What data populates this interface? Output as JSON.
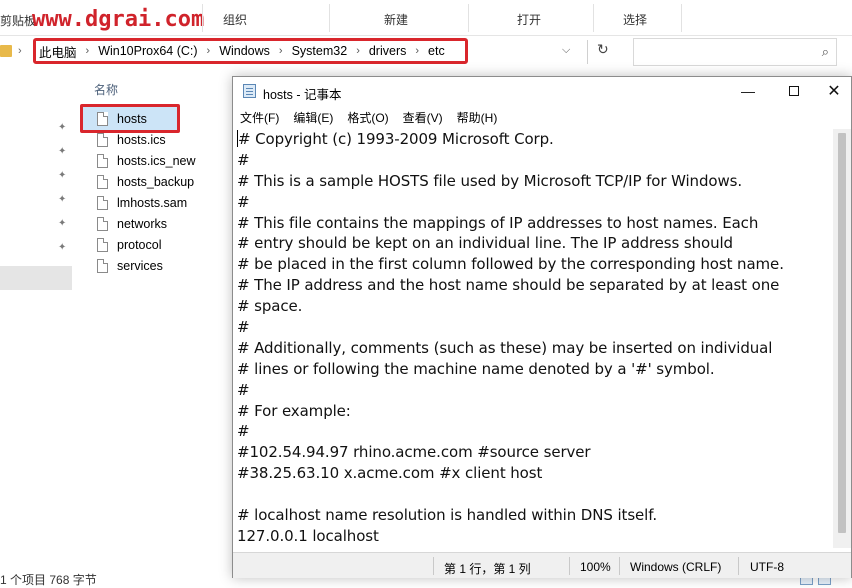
{
  "watermark": "www.dgrai.com",
  "ribbon": {
    "clipboard": "剪贴板",
    "organize": "组织",
    "new": "新建",
    "open": "打开",
    "select": "选择"
  },
  "address": {
    "crumbs": [
      "此电脑",
      "Win10Prox64 (C:)",
      "Windows",
      "System32",
      "drivers",
      "etc"
    ],
    "separator": "›"
  },
  "file_list": {
    "column_header": "名称",
    "files": [
      "hosts",
      "hosts.ics",
      "hosts.ics_new",
      "hosts_backup",
      "lmhosts.sam",
      "networks",
      "protocol",
      "services"
    ]
  },
  "explorer_status": "1 个项目   768 字节",
  "notepad": {
    "title": "hosts - 记事本",
    "menu": [
      "文件(F)",
      "编辑(E)",
      "格式(O)",
      "查看(V)",
      "帮助(H)"
    ],
    "lines": [
      "# Copyright (c) 1993-2009 Microsoft Corp.",
      "#",
      "# This is a sample HOSTS file used by Microsoft TCP/IP for Windows.",
      "#",
      "# This file contains the mappings of IP addresses to host names. Each",
      "# entry should be kept on an individual line. The IP address should",
      "# be placed in the first column followed by the corresponding host name.",
      "# The IP address and the host name should be separated by at least one",
      "# space.",
      "#",
      "# Additionally, comments (such as these) may be inserted on individual",
      "# lines or following the machine name denoted by a '#' symbol.",
      "#",
      "# For example:",
      "#",
      "#102.54.94.97 rhino.acme.com #source server",
      "#38.25.63.10 x.acme.com #x client host",
      "",
      "# localhost name resolution is handled within DNS itself.",
      "127.0.0.1 localhost"
    ],
    "status": {
      "position": "第 1 行，第 1 列",
      "zoom": "100%",
      "line_ending": "Windows (CRLF)",
      "encoding": "UTF-8"
    }
  },
  "icons": {
    "minimize": "minimize-icon",
    "maximize": "maximize-icon",
    "close": "close-icon",
    "search": "search-icon",
    "refresh": "refresh-icon",
    "pin": "pin-icon",
    "file": "file-icon"
  },
  "colors": {
    "highlight_red": "#d9262c",
    "selection_blue": "#cce4f7"
  }
}
